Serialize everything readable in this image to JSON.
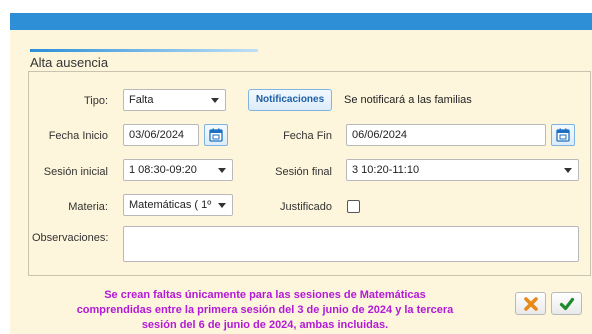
{
  "dialog": {
    "title": "Alta ausencia",
    "colors": {
      "header": "#2f8fd6",
      "background": "#fdf6dc",
      "message": "#b319d8"
    }
  },
  "form": {
    "tipo": {
      "label": "Tipo:",
      "value": "Falta"
    },
    "notificaciones_label": "Notificaciones",
    "notify_text": "Se notificará a las familias",
    "fecha_inicio": {
      "label": "Fecha Inicio",
      "value": "03/06/2024",
      "icon": "calendar-icon"
    },
    "fecha_fin": {
      "label": "Fecha Fin",
      "value": "06/06/2024",
      "icon": "calendar-icon"
    },
    "sesion_inicial": {
      "label": "Sesión inicial",
      "value": "1 08:30-09:20"
    },
    "sesion_final": {
      "label": "Sesión final",
      "value": "3 10:20-11:10"
    },
    "materia": {
      "label": "Materia:",
      "value": "Matemáticas ( 1º"
    },
    "justificado": {
      "label": "Justificado",
      "checked": false
    },
    "observaciones": {
      "label": "Observaciones:",
      "value": ""
    }
  },
  "message": {
    "line1": "Se crean faltas únicamente para las sesiones de Matemáticas",
    "line2": "comprendidas entre la primera sesión del 3 de junio de 2024 y la tercera",
    "line3": "sesión del 6 de junio de 2024, ambas incluidas."
  },
  "actions": {
    "cancel_icon": "close-icon",
    "cancel_color": "#e8891a",
    "confirm_icon": "check-icon",
    "confirm_color": "#1f8a2b"
  }
}
